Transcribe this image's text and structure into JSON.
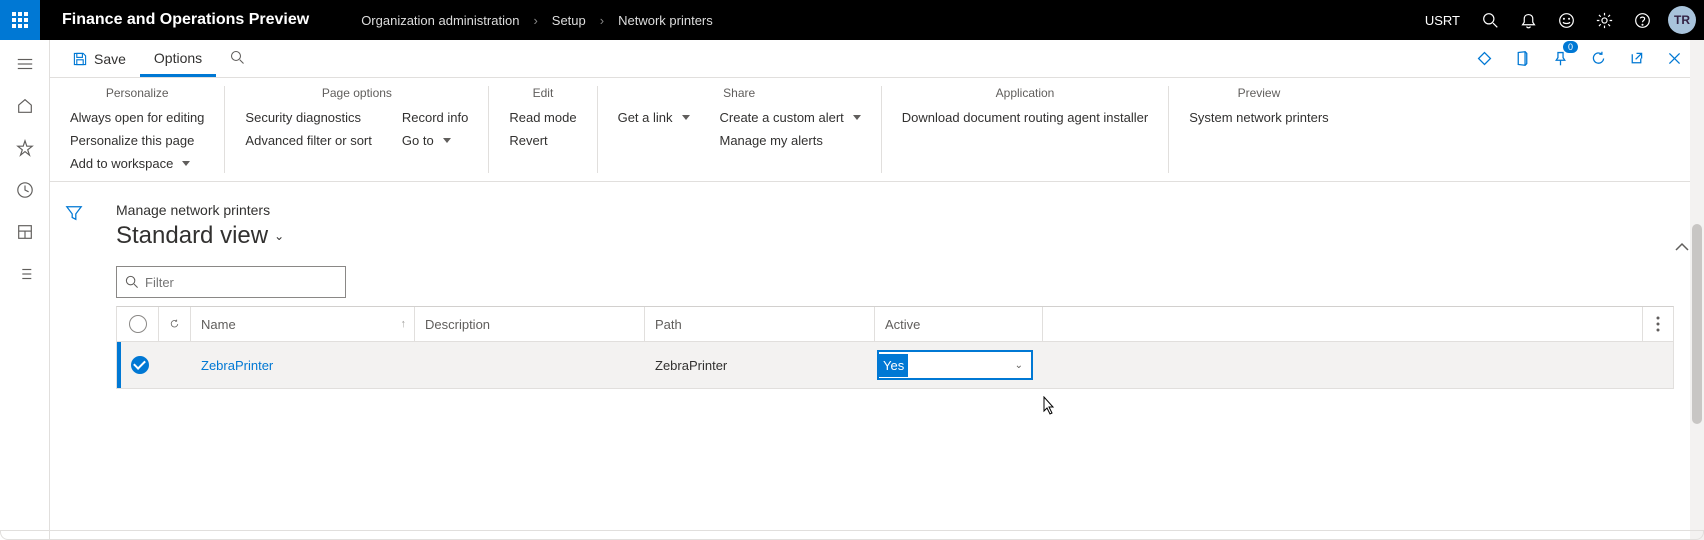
{
  "topbar": {
    "app_title": "Finance and Operations Preview",
    "breadcrumb": [
      "Organization administration",
      "Setup",
      "Network printers"
    ],
    "company": "USRT",
    "avatar": "TR"
  },
  "actionbar": {
    "save": "Save",
    "tab_options": "Options",
    "notification_count": "0"
  },
  "ribbon": {
    "personalize": {
      "title": "Personalize",
      "always_open": "Always open for editing",
      "this_page": "Personalize this page",
      "add_workspace": "Add to workspace"
    },
    "page_options": {
      "title": "Page options",
      "security": "Security diagnostics",
      "adv_filter": "Advanced filter or sort",
      "record_info": "Record info",
      "go_to": "Go to"
    },
    "edit": {
      "title": "Edit",
      "read_mode": "Read mode",
      "revert": "Revert"
    },
    "share": {
      "title": "Share",
      "get_link": "Get a link",
      "custom_alert": "Create a custom alert",
      "manage_alerts": "Manage my alerts"
    },
    "application": {
      "title": "Application",
      "download": "Download document routing agent installer"
    },
    "preview": {
      "title": "Preview",
      "sys_printers": "System network printers"
    }
  },
  "page": {
    "subtitle": "Manage network printers",
    "view": "Standard view",
    "filter_placeholder": "Filter"
  },
  "grid": {
    "headers": {
      "name": "Name",
      "description": "Description",
      "path": "Path",
      "active": "Active"
    },
    "rows": [
      {
        "name": "ZebraPrinter",
        "description": "",
        "path": "ZebraPrinter",
        "active": "Yes",
        "selected": true
      }
    ]
  }
}
